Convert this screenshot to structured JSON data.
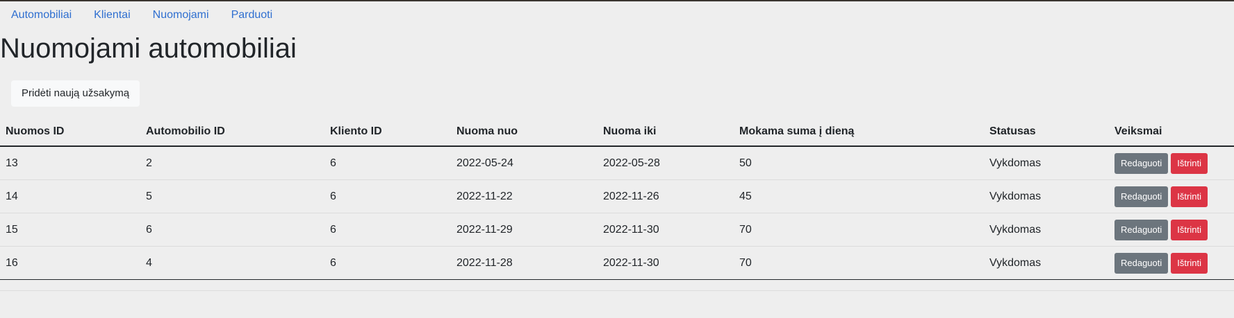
{
  "nav": {
    "items": [
      {
        "label": "Automobiliai"
      },
      {
        "label": "Klientai"
      },
      {
        "label": "Nuomojami"
      },
      {
        "label": "Parduoti"
      }
    ]
  },
  "page": {
    "title": "Nuomojami automobiliai",
    "add_button_label": "Pridėti naują užsakymą"
  },
  "table": {
    "headers": [
      "Nuomos ID",
      "Automobilio ID",
      "Kliento ID",
      "Nuoma nuo",
      "Nuoma iki",
      "Mokama suma į dieną",
      "Statusas",
      "Veiksmai"
    ],
    "rows": [
      {
        "cells": [
          "13",
          "2",
          "6",
          "2022-05-24",
          "2022-05-28",
          "50",
          "Vykdomas"
        ],
        "edit_label": "Redaguoti",
        "delete_label": "Ištrinti"
      },
      {
        "cells": [
          "14",
          "5",
          "6",
          "2022-11-22",
          "2022-11-26",
          "45",
          "Vykdomas"
        ],
        "edit_label": "Redaguoti",
        "delete_label": "Ištrinti"
      },
      {
        "cells": [
          "15",
          "6",
          "6",
          "2022-11-29",
          "2022-11-30",
          "70",
          "Vykdomas"
        ],
        "edit_label": "Redaguoti",
        "delete_label": "Ištrinti"
      },
      {
        "cells": [
          "16",
          "4",
          "6",
          "2022-11-28",
          "2022-11-30",
          "70",
          "Vykdomas"
        ],
        "edit_label": "Redaguoti",
        "delete_label": "Ištrinti"
      }
    ]
  },
  "colors": {
    "link": "#2f6fd0",
    "edit_button": "#6c757d",
    "delete_button": "#dc3545",
    "background": "#eeeeee"
  }
}
